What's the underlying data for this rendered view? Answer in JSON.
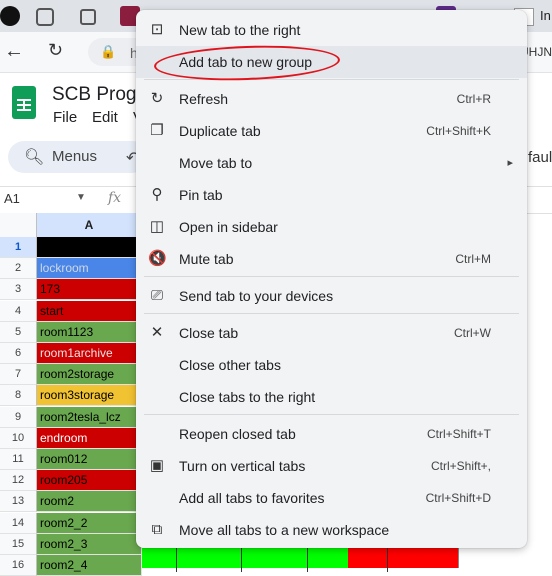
{
  "browser": {
    "tab_strip": {
      "partial_tab_text": "In"
    },
    "toolbar": {
      "omnibox_text": "h",
      "extension_text": "UHJN"
    }
  },
  "sheets": {
    "title": "SCB Progre",
    "menu": [
      "File",
      "Edit",
      "V"
    ],
    "search_label": "Menus",
    "toolbar_partial": "faul",
    "name_box": "A1",
    "fx": "fx",
    "column_header": "A",
    "rows": [
      {
        "num": "1",
        "text": "",
        "bg": "#000000",
        "fg": "#ffffff"
      },
      {
        "num": "2",
        "text": "lockroom",
        "bg": "#4a86e8",
        "fg": "#cfd8e3"
      },
      {
        "num": "3",
        "text": "173",
        "bg": "#cc0000",
        "fg": "#000000"
      },
      {
        "num": "4",
        "text": "start",
        "bg": "#cc0000",
        "fg": "#000000"
      },
      {
        "num": "5",
        "text": "room1123",
        "bg": "#6aa84f",
        "fg": "#000000"
      },
      {
        "num": "6",
        "text": "room1archive",
        "bg": "#cc0000",
        "fg": "#e6e6e6"
      },
      {
        "num": "7",
        "text": "room2storage",
        "bg": "#6aa84f",
        "fg": "#000000"
      },
      {
        "num": "8",
        "text": "room3storage",
        "bg": "#f1c232",
        "fg": "#000000"
      },
      {
        "num": "9",
        "text": "room2tesla_lcz",
        "bg": "#6aa84f",
        "fg": "#000000"
      },
      {
        "num": "10",
        "text": "endroom",
        "bg": "#cc0000",
        "fg": "#ffffff"
      },
      {
        "num": "11",
        "text": "room012",
        "bg": "#6aa84f",
        "fg": "#000000"
      },
      {
        "num": "12",
        "text": "room205",
        "bg": "#cc0000",
        "fg": "#000000"
      },
      {
        "num": "13",
        "text": "room2",
        "bg": "#6aa84f",
        "fg": "#000000"
      },
      {
        "num": "14",
        "text": "room2_2",
        "bg": "#6aa84f",
        "fg": "#000000"
      },
      {
        "num": "15",
        "text": "room2_3",
        "bg": "#6aa84f",
        "fg": "#000000"
      },
      {
        "num": "16",
        "text": "room2_4",
        "bg": "#6aa84f",
        "fg": "#000000"
      }
    ]
  },
  "context_menu": {
    "items": [
      {
        "id": "new-tab-right",
        "icon": "new-tab-icon",
        "glyph": "⊡",
        "label": "New tab to the right",
        "shortcut": ""
      },
      {
        "id": "add-tab-group",
        "icon": "",
        "glyph": "",
        "label": "Add tab to new group",
        "shortcut": "",
        "highlighted": true
      },
      {
        "id": "refresh",
        "icon": "refresh-icon",
        "glyph": "↻",
        "label": "Refresh",
        "shortcut": "Ctrl+R"
      },
      {
        "id": "duplicate",
        "icon": "duplicate-icon",
        "glyph": "❐",
        "label": "Duplicate tab",
        "shortcut": "Ctrl+Shift+K"
      },
      {
        "id": "move-tab",
        "icon": "",
        "glyph": "",
        "label": "Move tab to",
        "shortcut": "▸"
      },
      {
        "id": "pin",
        "icon": "pin-icon",
        "glyph": "⚲",
        "label": "Pin tab",
        "shortcut": ""
      },
      {
        "id": "open-sidebar",
        "icon": "sidebar-icon",
        "glyph": "◫",
        "label": "Open in sidebar",
        "shortcut": ""
      },
      {
        "id": "mute",
        "icon": "speaker-mute-icon",
        "glyph": "🔇",
        "label": "Mute tab",
        "shortcut": "Ctrl+M"
      },
      {
        "id": "send-devices",
        "icon": "devices-icon",
        "glyph": "⎚",
        "label": "Send tab to your devices",
        "shortcut": ""
      },
      {
        "id": "close",
        "icon": "close-icon",
        "glyph": "✕",
        "label": "Close tab",
        "shortcut": "Ctrl+W"
      },
      {
        "id": "close-others",
        "icon": "",
        "glyph": "",
        "label": "Close other tabs",
        "shortcut": ""
      },
      {
        "id": "close-right",
        "icon": "",
        "glyph": "",
        "label": "Close tabs to the right",
        "shortcut": ""
      },
      {
        "id": "reopen",
        "icon": "",
        "glyph": "",
        "label": "Reopen closed tab",
        "shortcut": "Ctrl+Shift+T"
      },
      {
        "id": "vertical-tabs",
        "icon": "vertical-tabs-icon",
        "glyph": "▣",
        "label": "Turn on vertical tabs",
        "shortcut": "Ctrl+Shift+,"
      },
      {
        "id": "add-favorites",
        "icon": "",
        "glyph": "",
        "label": "Add all tabs to favorites",
        "shortcut": "Ctrl+Shift+D"
      },
      {
        "id": "move-workspace",
        "icon": "workspace-icon",
        "glyph": "⧉",
        "label": "Move all tabs to a new workspace",
        "shortcut": ""
      }
    ]
  },
  "colors": {
    "annotation_red": "#e0141c",
    "green_fill": "#00ff00",
    "red_fill": "#ff0000"
  }
}
